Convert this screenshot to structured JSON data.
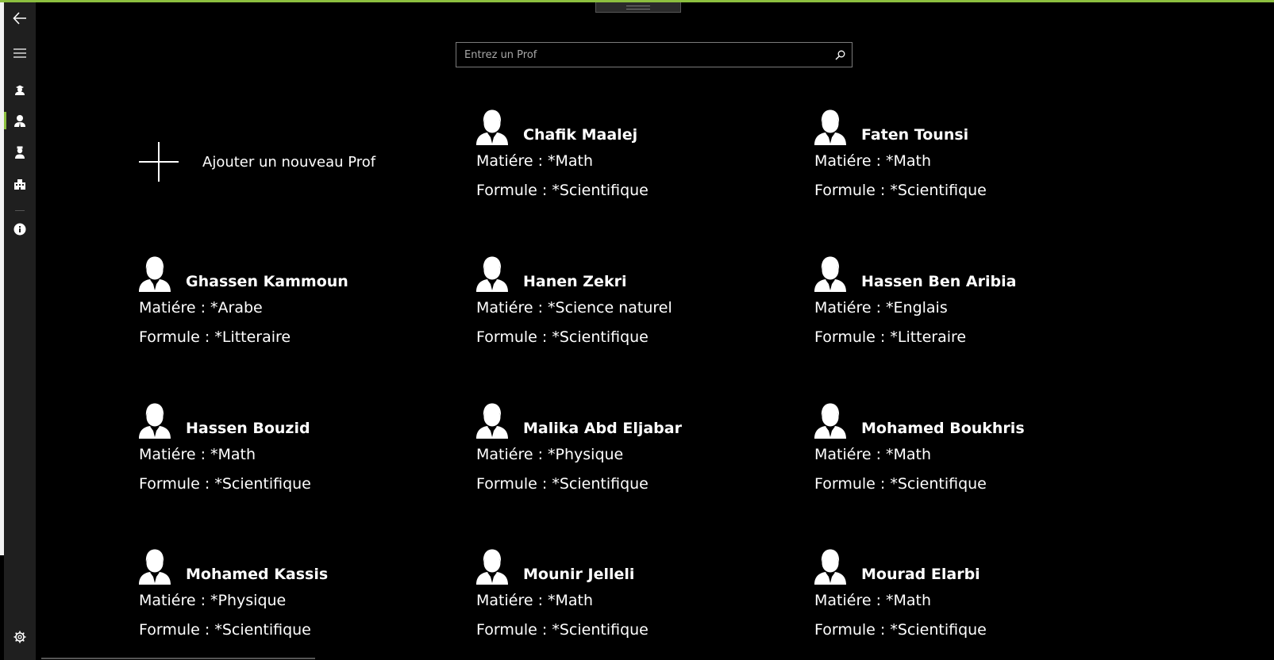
{
  "search": {
    "placeholder": "Entrez un Prof",
    "value": ""
  },
  "nav": {
    "items": [
      {
        "name": "back",
        "icon": "back-arrow-icon"
      },
      {
        "name": "menu",
        "icon": "hamburger-icon"
      },
      {
        "name": "students",
        "icon": "students-icon"
      },
      {
        "name": "professors",
        "icon": "professor-icon",
        "active": true
      },
      {
        "name": "staff",
        "icon": "staff-icon"
      },
      {
        "name": "school",
        "icon": "building-icon"
      },
      {
        "name": "about",
        "icon": "info-icon"
      },
      {
        "name": "settings",
        "icon": "gear-icon"
      }
    ],
    "accent": "#8cbf3f"
  },
  "add_tile": {
    "label": "Ajouter un nouveau Prof",
    "icon": "plus-icon"
  },
  "profs": [
    {
      "name": "Chafik Maalej",
      "matiere": "Matiére : *Math",
      "formule": "Formule : *Scientifique"
    },
    {
      "name": "Faten Tounsi",
      "matiere": "Matiére : *Math",
      "formule": "Formule : *Scientifique"
    },
    {
      "name": "Ghassen Kammoun",
      "matiere": "Matiére : *Arabe",
      "formule": "Formule : *Litteraire"
    },
    {
      "name": "Hanen Zekri",
      "matiere": "Matiére : *Science naturel",
      "formule": "Formule : *Scientifique"
    },
    {
      "name": "Hassen Ben Aribia",
      "matiere": "Matiére : *Englais",
      "formule": "Formule : *Litteraire"
    },
    {
      "name": "Hassen Bouzid",
      "matiere": "Matiére : *Math",
      "formule": "Formule : *Scientifique"
    },
    {
      "name": "Malika Abd Eljabar",
      "matiere": "Matiére : *Physique",
      "formule": "Formule : *Scientifique"
    },
    {
      "name": "Mohamed Boukhris",
      "matiere": "Matiére : *Math",
      "formule": "Formule : *Scientifique"
    },
    {
      "name": "Mohamed Kassis",
      "matiere": "Matiére : *Physique",
      "formule": "Formule : *Scientifique"
    },
    {
      "name": "Mounir Jelleli",
      "matiere": "Matiére : *Math",
      "formule": "Formule : *Scientifique"
    },
    {
      "name": "Mourad Elarbi",
      "matiere": "Matiére : *Math",
      "formule": "Formule : *Scientifique"
    }
  ]
}
